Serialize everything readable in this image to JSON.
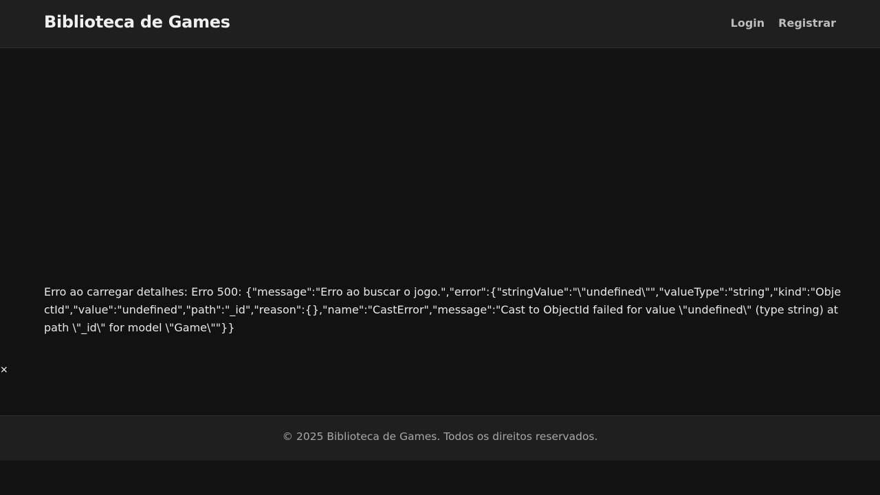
{
  "header": {
    "brand": "Biblioteca de Games",
    "nav": {
      "login": "Login",
      "register": "Registrar"
    }
  },
  "main": {
    "error_message": "Erro ao carregar detalhes: Erro 500: {\"message\":\"Erro ao buscar o jogo.\",\"error\":{\"stringValue\":\"\\\"undefined\\\"\",\"valueType\":\"string\",\"kind\":\"ObjectId\",\"value\":\"undefined\",\"path\":\"_id\",\"reason\":{},\"name\":\"CastError\",\"message\":\"Cast to ObjectId failed for value \\\"undefined\\\" (type string) at path \\\"_id\\\" for model \\\"Game\\\"\"}}",
    "close_symbol": "×"
  },
  "footer": {
    "copyright": "© 2025 Biblioteca de Games. Todos os direitos reservados."
  },
  "colors": {
    "background": "#121212",
    "surface": "#1f1f1f",
    "text": "#e8e8e8",
    "muted": "#a8a8a8"
  }
}
